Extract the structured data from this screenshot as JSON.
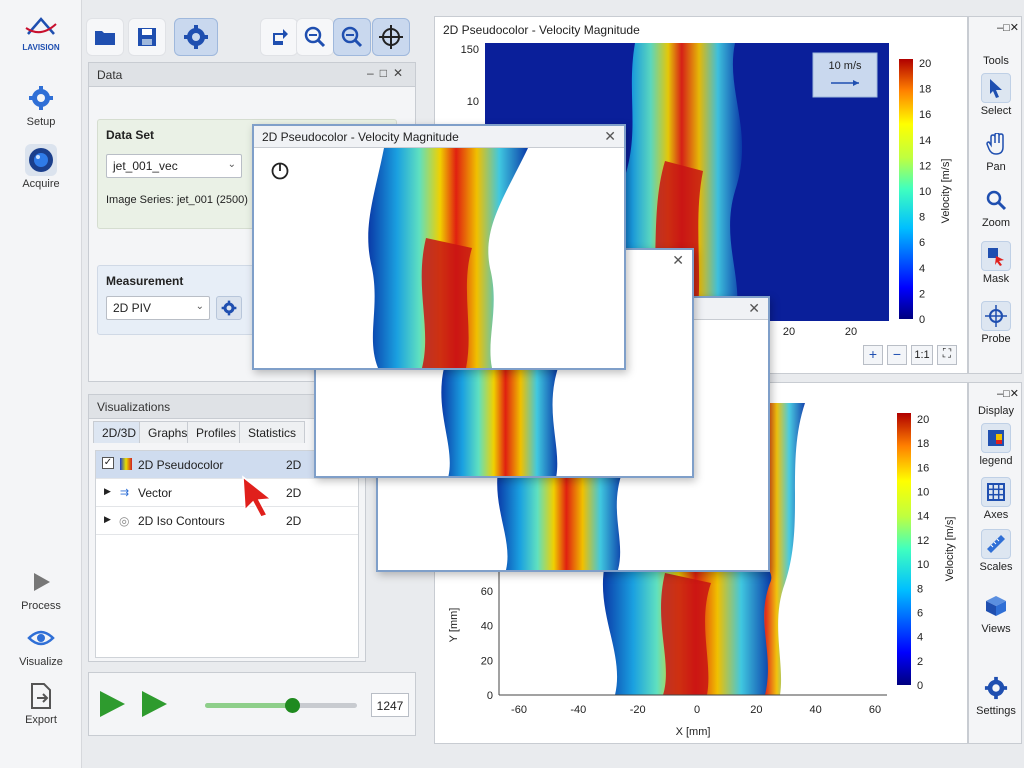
{
  "sidebar": {
    "logo_text": "LAVISION",
    "items": [
      {
        "label": "Setup",
        "icon": "gear-icon"
      },
      {
        "label": "Acquire",
        "icon": "camera-lens-icon"
      },
      {
        "label": "Process",
        "icon": "play-icon"
      },
      {
        "label": "Visualize",
        "icon": "eye-icon"
      },
      {
        "label": "Export",
        "icon": "export-document-icon"
      }
    ]
  },
  "toolbar": {
    "buttons": [
      "open-folder-icon",
      "save-icon",
      "settings-gear-icon",
      "rotate-icon",
      "zoom-out-icon",
      "zoom-in-icon",
      "crosshair-icon"
    ]
  },
  "data_panel": {
    "title": "Data",
    "dataset": {
      "title": "Data Set",
      "selected": "jet_001_vec",
      "image_series_label": "Image Series:",
      "image_series_value": "jet_001",
      "image_count": "(2500)"
    },
    "measurement": {
      "title": "Measurement",
      "selected": "2D PIV"
    }
  },
  "vis_panel": {
    "title": "Visualizations",
    "tabs": [
      "2D/3D",
      "Graphs",
      "Profiles",
      "Statistics"
    ],
    "rows": [
      {
        "label": "2D Pseudocolor",
        "dim": "2D",
        "checked": true
      },
      {
        "label": "Vector",
        "dim": "2D"
      },
      {
        "label": "2D Iso Contours",
        "dim": "2D"
      }
    ]
  },
  "playback": {
    "frame": "1247",
    "progress": 0.57
  },
  "top_plot": {
    "title": "2D Pseudocolor - Velocity Magnitude",
    "vector_label": "10 m/s",
    "y_ticks": [
      "150",
      "10"
    ],
    "x_ticks": [
      "20",
      "20"
    ],
    "colorbar_label": "Velocity [m/s]",
    "colorbar_ticks": [
      "20",
      "18",
      "16",
      "14",
      "12",
      "10",
      "8",
      "6",
      "4",
      "2",
      "0"
    ],
    "zoom_controls": [
      "+",
      "−",
      "1:1",
      "⛶"
    ]
  },
  "tools": {
    "title": "Tools",
    "items": [
      {
        "label": "Select",
        "icon": "cursor-icon"
      },
      {
        "label": "Pan",
        "icon": "hand-icon"
      },
      {
        "label": "Zoom",
        "icon": "magnifier-icon"
      },
      {
        "label": "Mask",
        "icon": "mask-icon"
      },
      {
        "label": "Probe",
        "icon": "probe-crosshair-icon"
      }
    ]
  },
  "bottom_plot": {
    "ylabel": "Y [mm]",
    "xlabel": "X [mm]",
    "y_ticks": [
      "60",
      "40",
      "20",
      "0"
    ],
    "x_ticks": [
      "-60",
      "-40",
      "-20",
      "0",
      "20",
      "40",
      "60"
    ],
    "colorbar_label": "Velocity [m/s]",
    "colorbar_ticks": [
      "20",
      "18",
      "16",
      "10",
      "14",
      "12",
      "10",
      "8",
      "6",
      "4",
      "2",
      "0"
    ]
  },
  "display": {
    "title": "Display",
    "items": [
      {
        "label": "legend",
        "icon": "legend-icon"
      },
      {
        "label": "Axes",
        "icon": "grid-icon"
      },
      {
        "label": "Scales",
        "icon": "ruler-icon"
      },
      {
        "label": "Views",
        "icon": "cube-icon"
      },
      {
        "label": "Settings",
        "icon": "gear-icon"
      }
    ]
  },
  "popup": {
    "title": "2D Pseudocolor - Velocity Magnitude"
  },
  "colors": {
    "accent": "#2f6fd6",
    "jet_high": "#c8102e",
    "jet_low": "#0a1a8c"
  }
}
